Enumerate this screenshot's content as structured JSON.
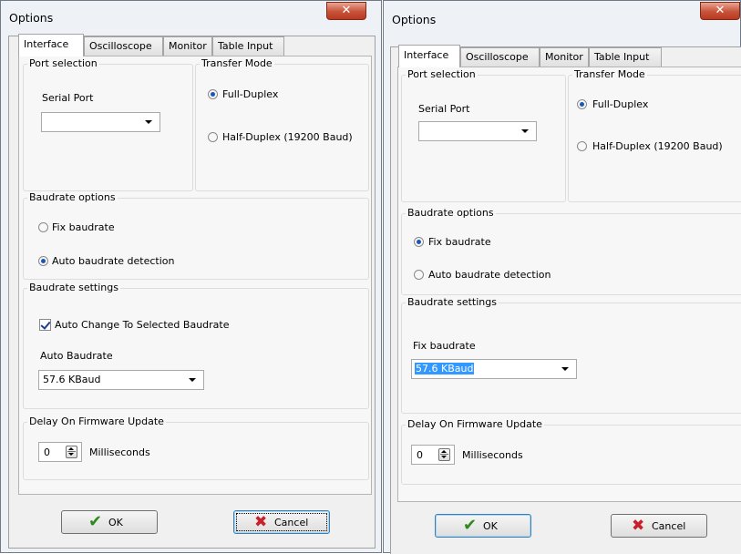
{
  "windows": [
    {
      "title": "Options",
      "close_glyph": "✕",
      "tabs": [
        "Interface",
        "Oscilloscope",
        "Monitor",
        "Table Input"
      ],
      "port_selection": {
        "label": "Port selection",
        "serial_port_label": "Serial Port",
        "serial_port_value": ""
      },
      "transfer_mode": {
        "label": "Transfer Mode",
        "full_duplex": "Full-Duplex",
        "half_duplex": "Half-Duplex (19200 Baud)",
        "selected": "Full-Duplex"
      },
      "baudrate_options": {
        "label": "Baudrate options",
        "fix": "Fix baudrate",
        "auto": "Auto baudrate detection",
        "selected": "Auto baudrate detection"
      },
      "baudrate_settings": {
        "label": "Baudrate settings",
        "checkbox_label": "Auto Change To  Selected Baudrate",
        "checkbox_checked": true,
        "field_label": "Auto Baudrate",
        "value": "57.6 KBaud"
      },
      "delay": {
        "label": "Delay On Firmware Update",
        "value": "0",
        "unit": "Milliseconds"
      },
      "ok_label": "OK",
      "cancel_label": "Cancel",
      "ok_icon": "✔",
      "cancel_icon": "✖"
    },
    {
      "title": "Options",
      "close_glyph": "✕",
      "tabs": [
        "Interface",
        "Oscilloscope",
        "Monitor",
        "Table Input"
      ],
      "port_selection": {
        "label": "Port selection",
        "serial_port_label": "Serial Port",
        "serial_port_value": ""
      },
      "transfer_mode": {
        "label": "Transfer Mode",
        "full_duplex": "Full-Duplex",
        "half_duplex": "Half-Duplex (19200 Baud)",
        "selected": "Full-Duplex"
      },
      "baudrate_options": {
        "label": "Baudrate options",
        "fix": "Fix baudrate",
        "auto": "Auto baudrate detection",
        "selected": "Fix baudrate"
      },
      "baudrate_settings": {
        "label": "Baudrate settings",
        "field_label": "Fix baudrate",
        "value": "57.6 KBaud"
      },
      "delay": {
        "label": "Delay On Firmware Update",
        "value": "0",
        "unit": "Milliseconds"
      },
      "ok_label": "OK",
      "cancel_label": "Cancel",
      "ok_icon": "✔",
      "cancel_icon": "✖"
    }
  ]
}
